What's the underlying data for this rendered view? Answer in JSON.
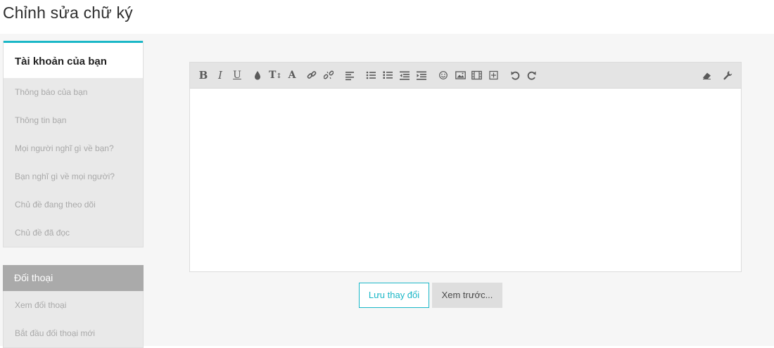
{
  "page": {
    "title": "Chỉnh sửa chữ ký"
  },
  "sidebar": {
    "account": {
      "heading": "Tài khoản của bạn",
      "items": [
        {
          "label": "Thông báo của bạn"
        },
        {
          "label": "Thông tin bạn"
        },
        {
          "label": "Mọi người nghĩ gì về bạn?"
        },
        {
          "label": "Bạn nghĩ gì về mọi người?"
        },
        {
          "label": "Chủ đề đang theo dõi"
        },
        {
          "label": "Chủ đề đã đọc"
        }
      ]
    },
    "conversations": {
      "heading": "Đối thoại",
      "items": [
        {
          "label": "Xem đối thoại"
        },
        {
          "label": "Bắt đầu đối thoại mới"
        }
      ]
    }
  },
  "editor": {
    "toolbar": {
      "bold": "B",
      "italic": "I",
      "underline": "U",
      "font_size": "T",
      "font_family": "A",
      "icons": [
        "bold-icon",
        "italic-icon",
        "underline-icon",
        "color-drop-icon",
        "text-size-icon",
        "font-icon",
        "link-icon",
        "unlink-icon",
        "align-icon",
        "bullet-list-icon",
        "numbered-list-icon",
        "outdent-icon",
        "indent-icon",
        "smiley-icon",
        "image-icon",
        "media-icon",
        "insert-icon",
        "undo-icon",
        "redo-icon",
        "eraser-icon",
        "wrench-icon"
      ]
    },
    "content": ""
  },
  "actions": {
    "save_label": "Lưu thay đổi",
    "preview_label": "Xem trước..."
  },
  "colors": {
    "accent": "#1ab7c7",
    "sidebar_bg": "#e9e9e9",
    "section_head_bg": "#aaaaaa"
  }
}
